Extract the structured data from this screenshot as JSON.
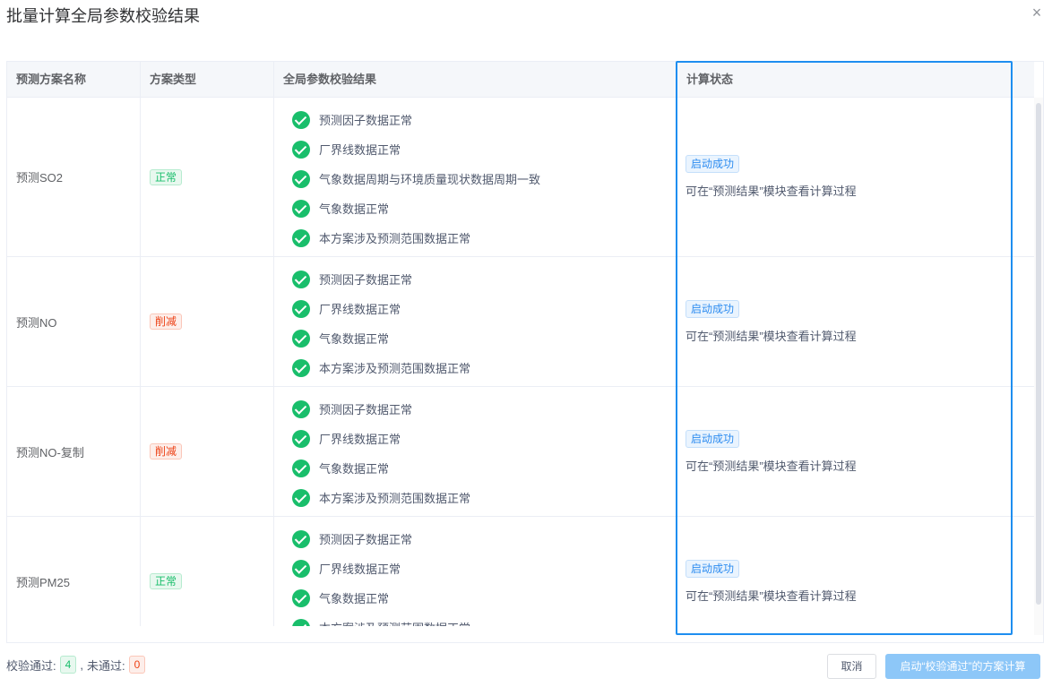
{
  "dialog": {
    "title": "批量计算全局参数校验结果",
    "close_glyph": "×"
  },
  "table": {
    "headers": [
      "预测方案名称",
      "方案类型",
      "全局参数校验结果",
      "计算状态"
    ],
    "rows": [
      {
        "name": "预测SO2",
        "type": "正常",
        "type_style": "ok",
        "checks": [
          "预测因子数据正常",
          "厂界线数据正常",
          "气象数据周期与环境质量现状数据周期一致",
          "气象数据正常",
          "本方案涉及预测范围数据正常"
        ],
        "status": "启动成功",
        "status_desc": "可在“预测结果”模块查看计算过程"
      },
      {
        "name": "预测NO",
        "type": "削减",
        "type_style": "cut",
        "checks": [
          "预测因子数据正常",
          "厂界线数据正常",
          "气象数据正常",
          "本方案涉及预测范围数据正常"
        ],
        "status": "启动成功",
        "status_desc": "可在“预测结果”模块查看计算过程"
      },
      {
        "name": "预测NO-复制",
        "type": "削减",
        "type_style": "cut",
        "checks": [
          "预测因子数据正常",
          "厂界线数据正常",
          "气象数据正常",
          "本方案涉及预测范围数据正常"
        ],
        "status": "启动成功",
        "status_desc": "可在“预测结果”模块查看计算过程"
      },
      {
        "name": "预测PM25",
        "type": "正常",
        "type_style": "ok",
        "checks": [
          "预测因子数据正常",
          "厂界线数据正常",
          "气象数据正常",
          "本方案涉及预测范围数据正常"
        ],
        "status": "启动成功",
        "status_desc": "可在“预测结果”模块查看计算过程"
      }
    ]
  },
  "footer": {
    "pass_label": "校验通过:",
    "pass_count": "4",
    "separator": ",",
    "fail_label": "未通过:",
    "fail_count": "0",
    "cancel_label": "取消",
    "start_label": "启动“校验通过”的方案计算"
  },
  "colors": {
    "accent": "#1e8ef0",
    "success": "#19be6b",
    "danger": "#ed4014",
    "primary_disabled": "#8dc7f8"
  },
  "icons": {
    "check": "check-circle-icon",
    "close": "close-icon"
  }
}
